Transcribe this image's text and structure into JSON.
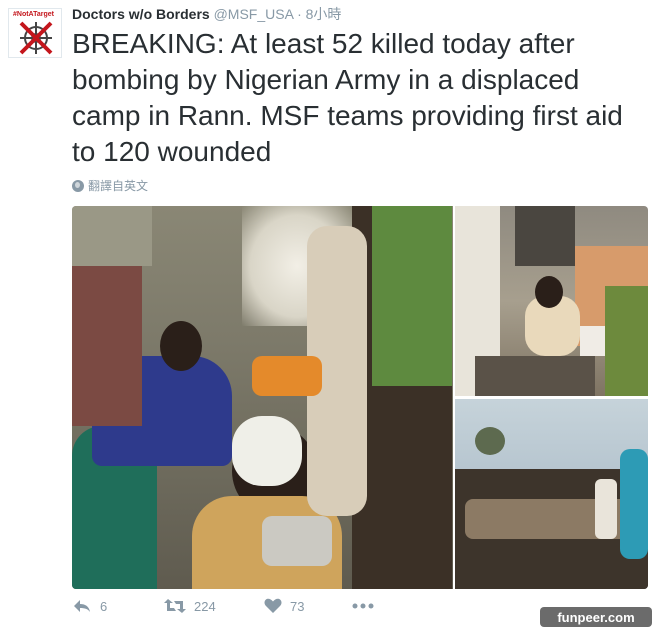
{
  "tweet": {
    "avatar_tag": "#NotATarget",
    "name": "Doctors w/o Borders",
    "handle": "@MSF_USA",
    "separator": "·",
    "time": "8小時",
    "text": "BREAKING: At least 52 killed today after bombing by Nigerian Army in a displaced camp in Rann. MSF teams providing first aid to 120 wounded",
    "translate_label": "翻譯自英文",
    "colors": {
      "text": "#292f33",
      "muted": "#8899a6",
      "brand": "#c4161c"
    }
  },
  "actions": {
    "reply": {
      "icon": "reply-icon",
      "count": "6"
    },
    "retweet": {
      "icon": "retweet-icon",
      "count": "224"
    },
    "like": {
      "icon": "heart-icon",
      "count": "73"
    },
    "more": {
      "icon": "more-icon"
    }
  },
  "watermark": {
    "text": "funpeer.com"
  }
}
